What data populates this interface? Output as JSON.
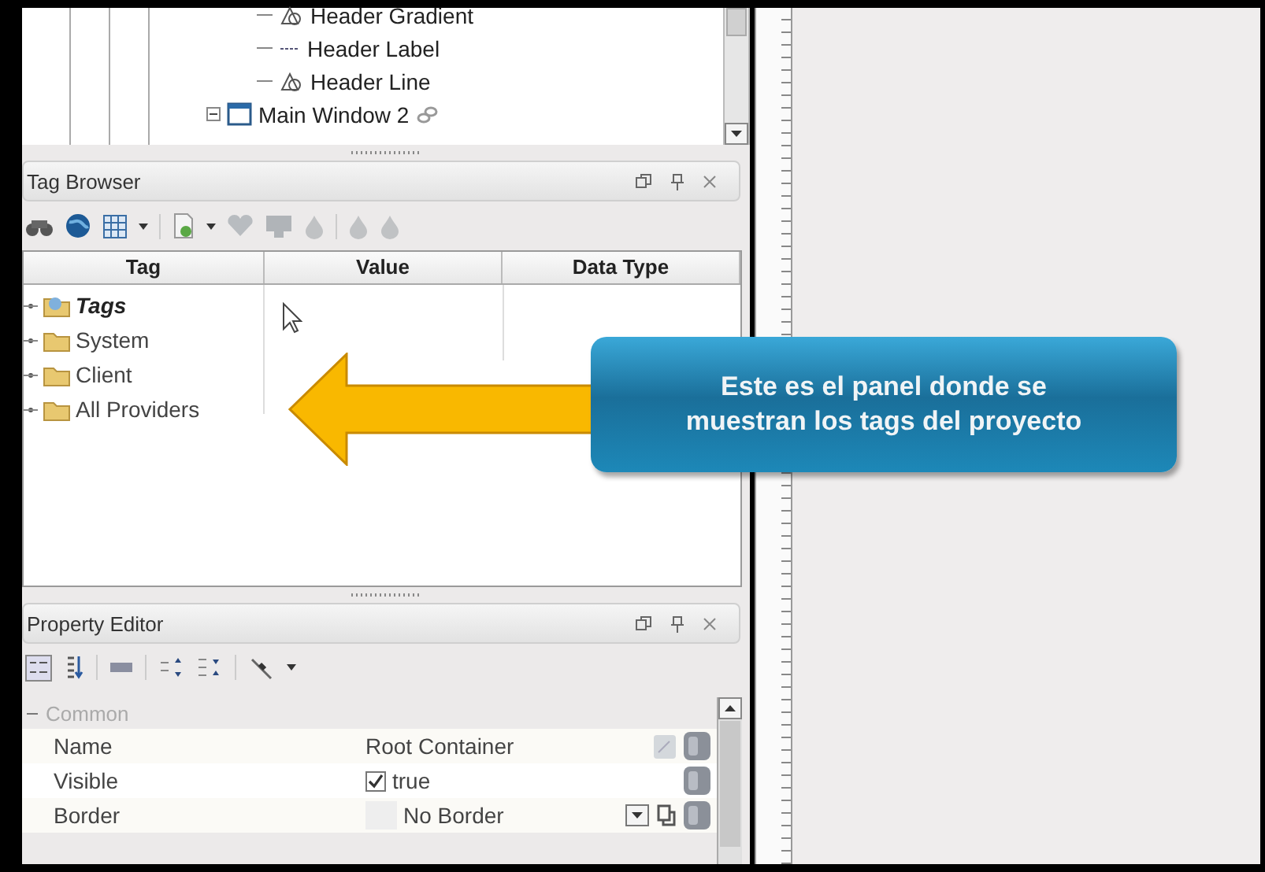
{
  "project_tree": [
    {
      "label": "Header Gradient",
      "kind": "shape"
    },
    {
      "label": "Header Label",
      "kind": "label"
    },
    {
      "label": "Header Line",
      "kind": "shape"
    },
    {
      "label": "Main Window 2",
      "kind": "window"
    }
  ],
  "tag_browser": {
    "title": "Tag Browser",
    "columns": [
      "Tag",
      "Value",
      "Data Type"
    ],
    "tree": [
      {
        "label": "Tags",
        "kind": "provider"
      },
      {
        "label": "System",
        "kind": "folder"
      },
      {
        "label": "Client",
        "kind": "folder"
      },
      {
        "label": "All Providers",
        "kind": "folder"
      }
    ]
  },
  "callout": {
    "text": "Este es el panel donde se\nmuestran los tags del proyecto"
  },
  "property_editor": {
    "title": "Property Editor",
    "group": {
      "label": "Common",
      "expanded": true
    },
    "rows": [
      {
        "name": "Name",
        "value": "Root Container",
        "kind": "text"
      },
      {
        "name": "Visible",
        "value": "true",
        "kind": "checkbox",
        "checked": true
      },
      {
        "name": "Border",
        "value": "No Border",
        "kind": "dropdown"
      }
    ]
  }
}
